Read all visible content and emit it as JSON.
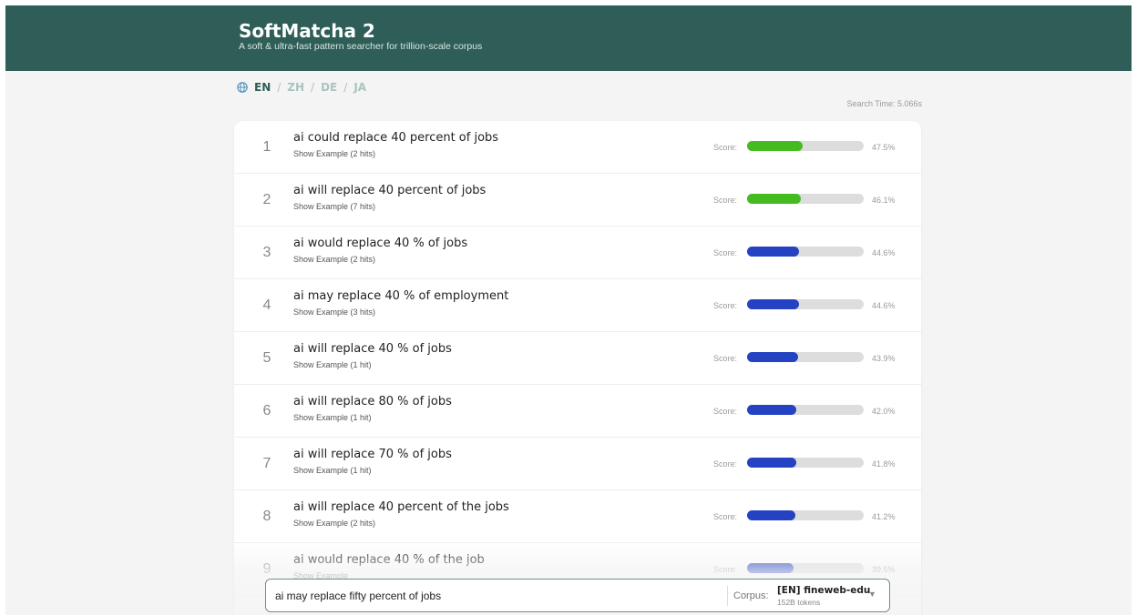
{
  "header": {
    "title": "SoftMatcha 2",
    "subtitle": "A soft & ultra-fast pattern searcher for trillion-scale corpus",
    "background_color": "#2e5e57"
  },
  "languages": {
    "icon": "globe-icon",
    "active": "EN",
    "items": [
      "EN",
      "ZH",
      "DE",
      "JA"
    ],
    "separator": "/"
  },
  "search_time": "Search Time: 5.066s",
  "results": [
    {
      "rank": "1",
      "phrase": "ai could replace 40 percent of jobs",
      "example": "Show Example (2 hits)",
      "score_label": "Score:",
      "score_text": "47.5%",
      "score": 0.475,
      "color": "#44bb1f"
    },
    {
      "rank": "2",
      "phrase": "ai will replace 40 percent of jobs",
      "example": "Show Example (7 hits)",
      "score_label": "Score:",
      "score_text": "46.1%",
      "score": 0.461,
      "color": "#44bb1f"
    },
    {
      "rank": "3",
      "phrase": "ai would replace 40 % of jobs",
      "example": "Show Example (2 hits)",
      "score_label": "Score:",
      "score_text": "44.6%",
      "score": 0.446,
      "color": "#2442c2"
    },
    {
      "rank": "4",
      "phrase": "ai may replace 40 % of employment",
      "example": "Show Example (3 hits)",
      "score_label": "Score:",
      "score_text": "44.6%",
      "score": 0.446,
      "color": "#2442c2"
    },
    {
      "rank": "5",
      "phrase": "ai will replace 40 % of jobs",
      "example": "Show Example (1 hit)",
      "score_label": "Score:",
      "score_text": "43.9%",
      "score": 0.439,
      "color": "#2442c2"
    },
    {
      "rank": "6",
      "phrase": "ai will replace 80 % of jobs",
      "example": "Show Example (1 hit)",
      "score_label": "Score:",
      "score_text": "42.0%",
      "score": 0.42,
      "color": "#2442c2"
    },
    {
      "rank": "7",
      "phrase": "ai will replace 70 % of jobs",
      "example": "Show Example (1 hit)",
      "score_label": "Score:",
      "score_text": "41.8%",
      "score": 0.418,
      "color": "#2442c2"
    },
    {
      "rank": "8",
      "phrase": "ai will replace 40 percent of the jobs",
      "example": "Show Example (2 hits)",
      "score_label": "Score:",
      "score_text": "41.2%",
      "score": 0.412,
      "color": "#2442c2"
    },
    {
      "rank": "9",
      "phrase": "ai would replace 40 % of the job",
      "example": "Show Example",
      "score_label": "Score:",
      "score_text": "39.5%",
      "score": 0.395,
      "color": "#2442c2"
    }
  ],
  "search": {
    "value": "ai may replace fifty percent of jobs",
    "corpus_label": "Corpus:",
    "corpus_name": "[EN] fineweb-edu",
    "corpus_tokens": "152B tokens",
    "caret_icon": "caret-down-icon"
  }
}
